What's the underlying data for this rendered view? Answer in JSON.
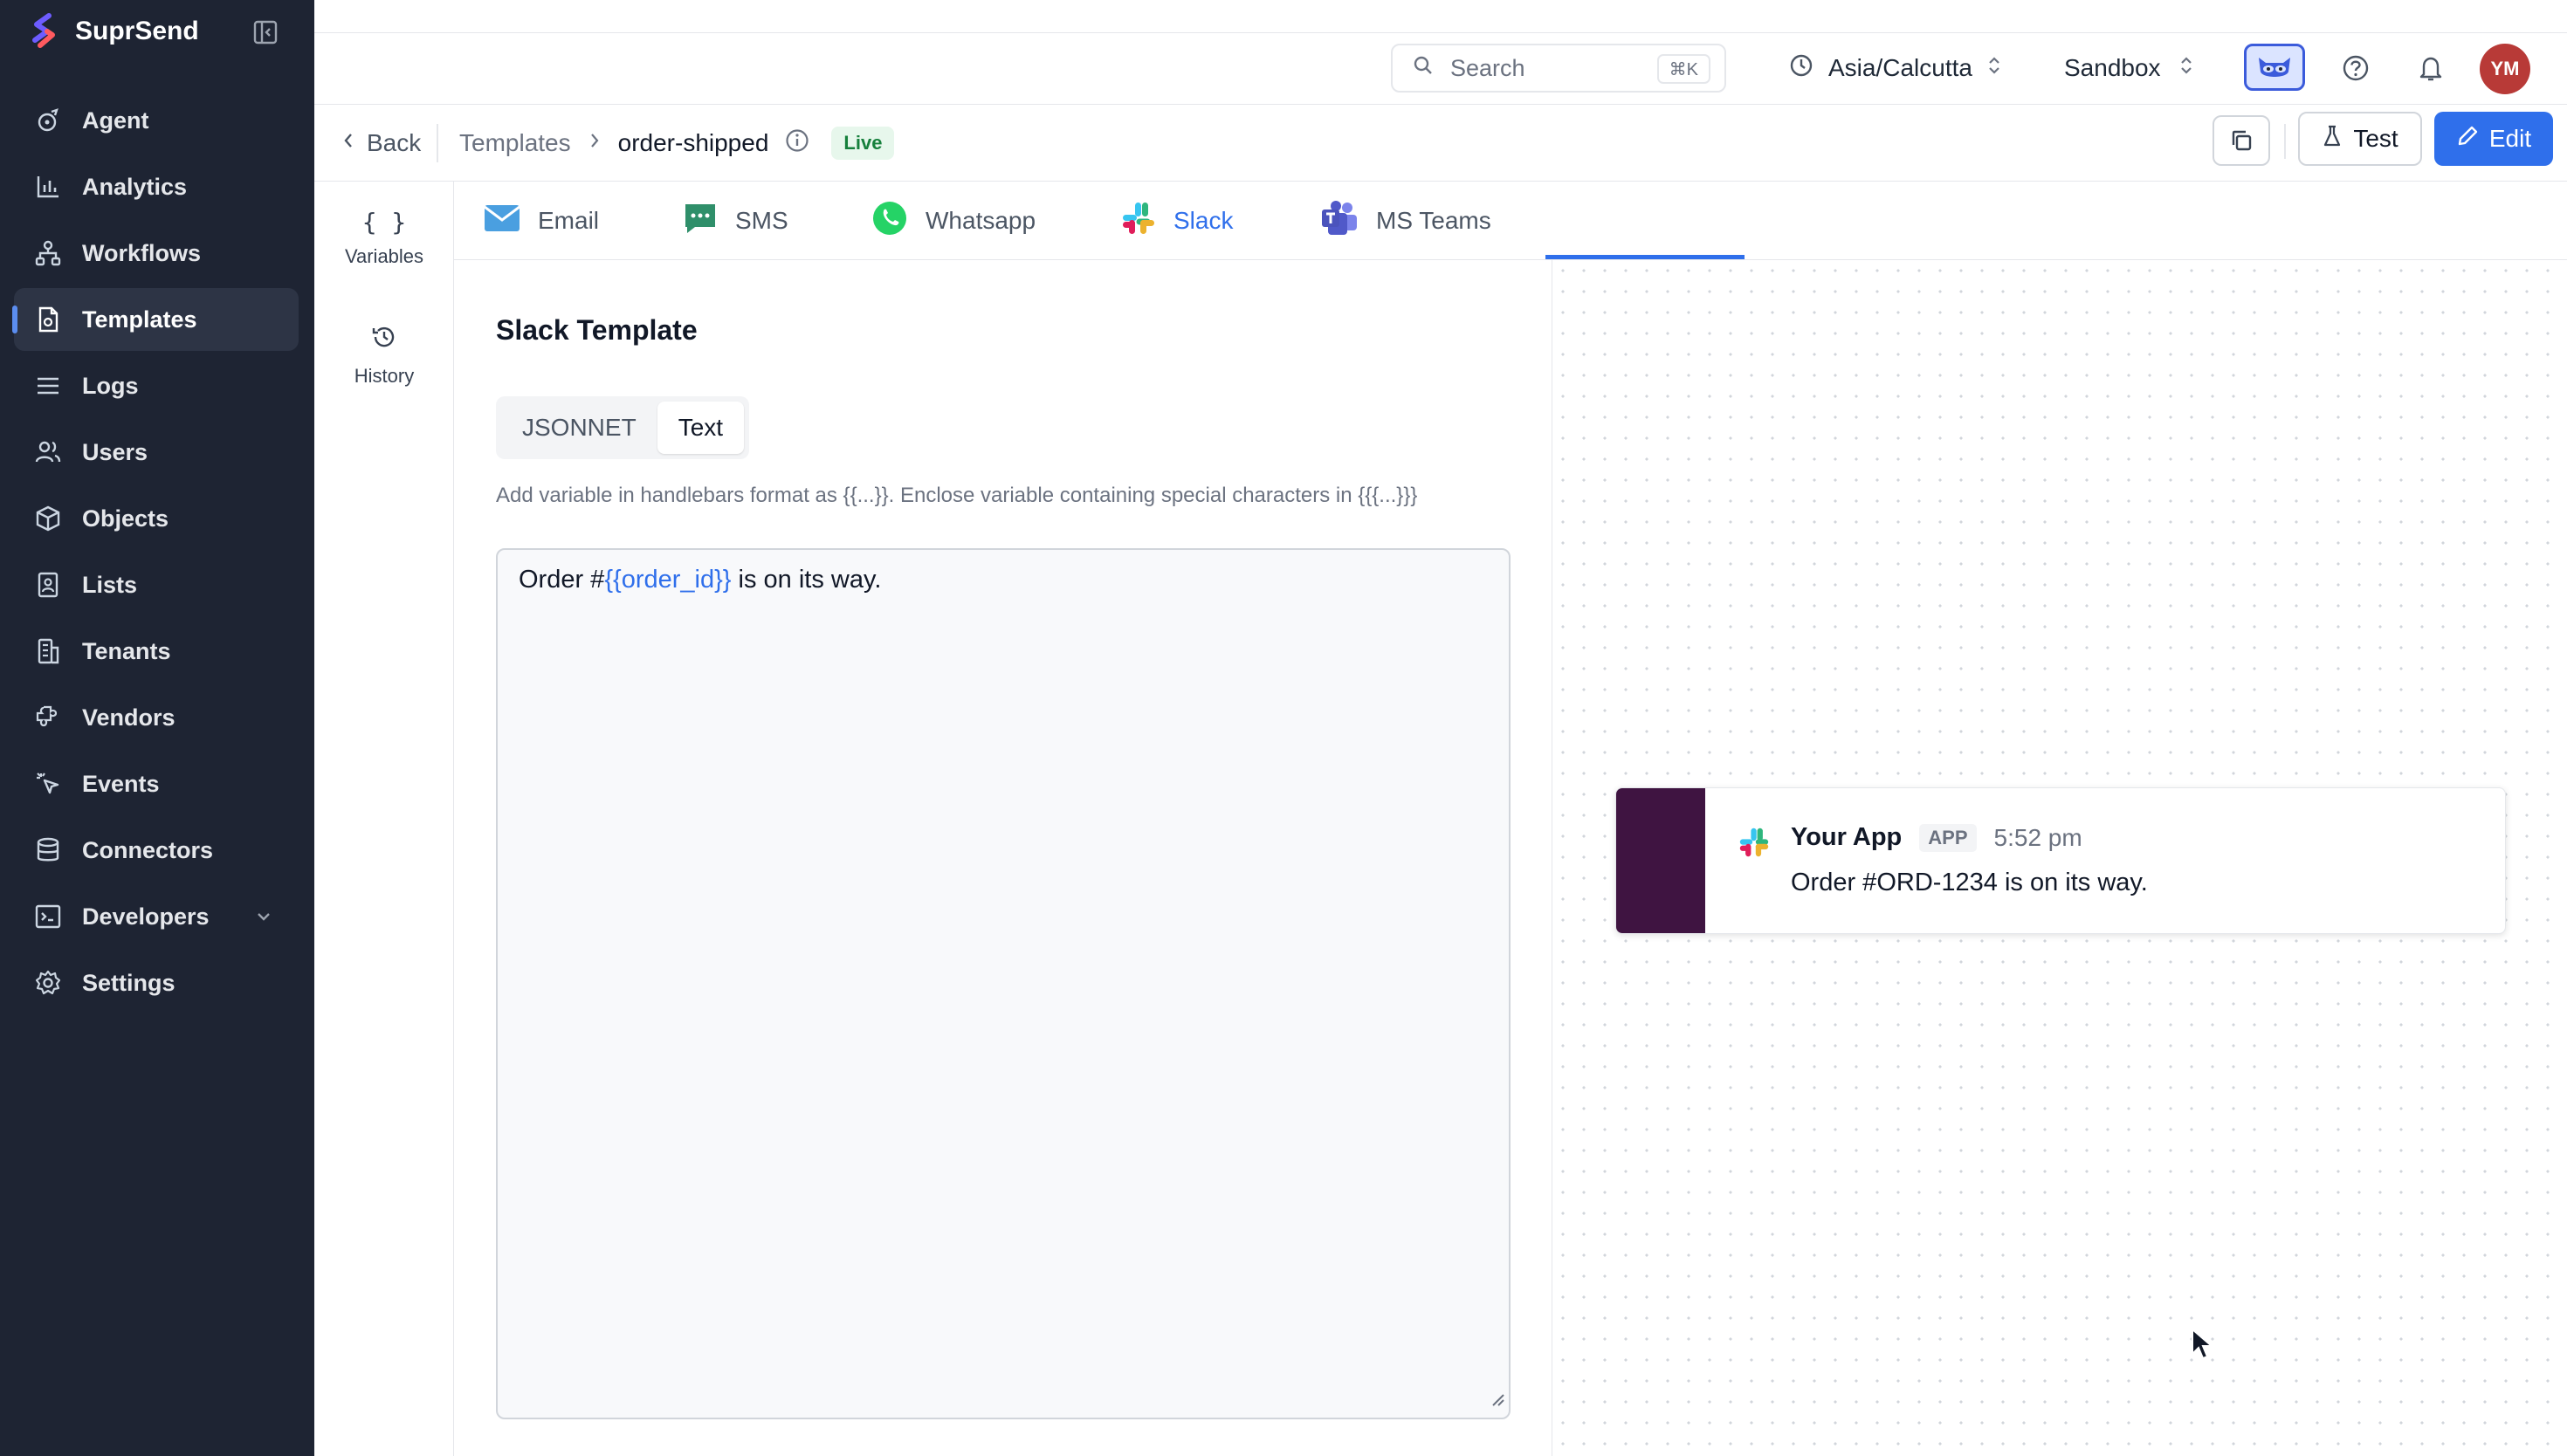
{
  "brand": {
    "name": "SuprSend"
  },
  "sidebar": {
    "items": [
      {
        "label": "Agent",
        "icon": "agent-icon"
      },
      {
        "label": "Analytics",
        "icon": "analytics-icon"
      },
      {
        "label": "Workflows",
        "icon": "workflows-icon"
      },
      {
        "label": "Templates",
        "icon": "templates-icon",
        "active": true
      },
      {
        "label": "Logs",
        "icon": "logs-icon"
      },
      {
        "label": "Users",
        "icon": "users-icon"
      },
      {
        "label": "Objects",
        "icon": "objects-icon"
      },
      {
        "label": "Lists",
        "icon": "lists-icon"
      },
      {
        "label": "Tenants",
        "icon": "tenants-icon"
      },
      {
        "label": "Vendors",
        "icon": "vendors-icon"
      },
      {
        "label": "Events",
        "icon": "events-icon"
      },
      {
        "label": "Connectors",
        "icon": "connectors-icon"
      },
      {
        "label": "Developers",
        "icon": "developers-icon",
        "expandable": true
      },
      {
        "label": "Settings",
        "icon": "settings-icon"
      }
    ]
  },
  "topbar": {
    "search_placeholder": "Search",
    "search_shortcut": "⌘K",
    "timezone": "Asia/Calcutta",
    "environment": "Sandbox",
    "avatar_initials": "YM"
  },
  "breadcrumb": {
    "back": "Back",
    "parent": "Templates",
    "current": "order-shipped",
    "status": "Live"
  },
  "actions": {
    "test": "Test",
    "edit": "Edit"
  },
  "rail": {
    "variables": "Variables",
    "history": "History"
  },
  "tabs": [
    {
      "label": "Email"
    },
    {
      "label": "SMS"
    },
    {
      "label": "Whatsapp"
    },
    {
      "label": "Slack",
      "active": true
    },
    {
      "label": "MS Teams"
    }
  ],
  "editor": {
    "title": "Slack Template",
    "modes": [
      "JSONNET",
      "Text"
    ],
    "active_mode": "Text",
    "helper": "Add variable in handlebars format as {{...}}. Enclose variable containing special characters in {{{...}}}",
    "content_prefix": "Order #",
    "content_variable": "{{order_id}}",
    "content_suffix": " is on its way."
  },
  "preview": {
    "app_name": "Your App",
    "app_tag": "APP",
    "time": "5:52 pm",
    "message": "Order #ORD-1234 is on its way."
  },
  "colors": {
    "sidebar_bg": "#1e2433",
    "accent": "#2f6feb",
    "live_green": "#16803c",
    "slack_aubergine": "#3f1441",
    "avatar_red": "#b83a37"
  }
}
